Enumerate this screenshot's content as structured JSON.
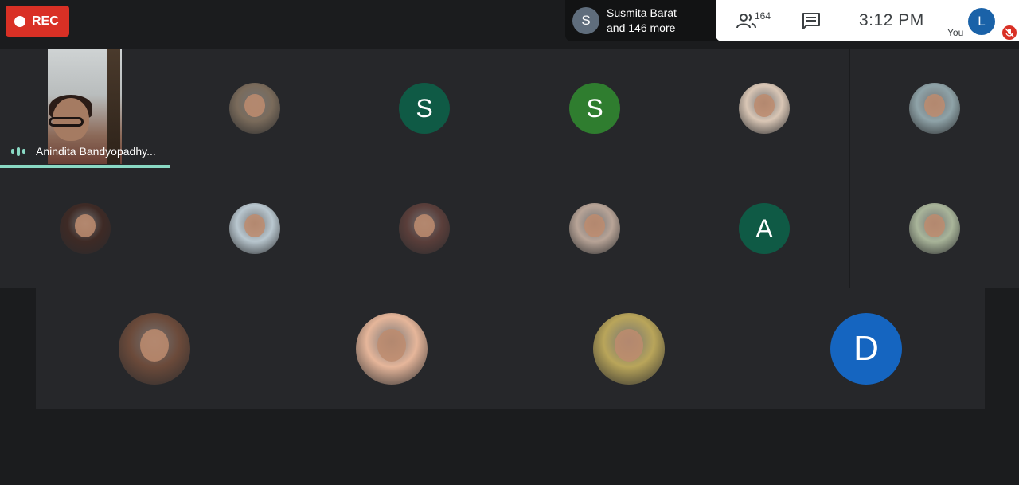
{
  "recording": {
    "label": "REC"
  },
  "join_notice": {
    "avatar_letter": "S",
    "line1": "Susmita Barat",
    "line2": "and 146 more"
  },
  "controls": {
    "people_icon": "people-icon",
    "participant_count": "164",
    "chat_icon": "chat-icon",
    "time": "3:12  PM",
    "self_avatar_letter": "L",
    "self_label": "You",
    "mic_status_icon": "mic-off-icon"
  },
  "speaker": {
    "name": "Anindita Bandyopadhy..."
  },
  "participants": [
    {
      "id": "p-row1-2",
      "type": "photo",
      "letter": "",
      "color": "#7a6b5b"
    },
    {
      "id": "p-row1-3",
      "type": "letter",
      "letter": "S",
      "color": "#0f5a45"
    },
    {
      "id": "p-row1-4",
      "type": "letter",
      "letter": "S",
      "color": "#2f7d2f"
    },
    {
      "id": "p-row1-5",
      "type": "photo",
      "letter": "",
      "color": "#d9c6b5"
    },
    {
      "id": "p-row1-6",
      "type": "photo",
      "letter": "",
      "color": "#8fa3a8"
    },
    {
      "id": "p-row2-1",
      "type": "photo",
      "letter": "",
      "color": "#3e2a25"
    },
    {
      "id": "p-row2-2",
      "type": "photo",
      "letter": "",
      "color": "#b9c7cf"
    },
    {
      "id": "p-row2-3",
      "type": "photo",
      "letter": "",
      "color": "#5a3e3a"
    },
    {
      "id": "p-row2-4",
      "type": "photo",
      "letter": "",
      "color": "#b8a497"
    },
    {
      "id": "p-row2-5",
      "type": "letter",
      "letter": "A",
      "color": "#0f5a45"
    },
    {
      "id": "p-row2-6",
      "type": "photo",
      "letter": "",
      "color": "#a9b59a"
    },
    {
      "id": "p-row3-1",
      "type": "photo",
      "letter": "",
      "color": "#6b4a3a"
    },
    {
      "id": "p-row3-2",
      "type": "photo",
      "letter": "",
      "color": "#e6b69a"
    },
    {
      "id": "p-row3-3",
      "type": "photo",
      "letter": "",
      "color": "#b9a55a"
    },
    {
      "id": "p-row3-4",
      "type": "letter",
      "letter": "D",
      "color": "#1565c0"
    }
  ]
}
